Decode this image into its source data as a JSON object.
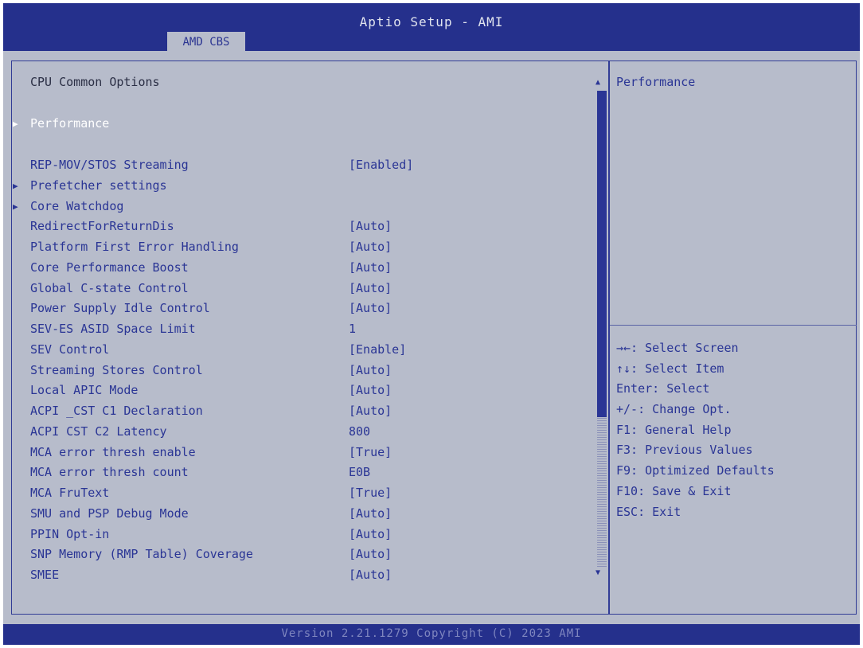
{
  "header": {
    "title": "Aptio Setup - AMI",
    "tab": "AMD CBS"
  },
  "main": {
    "section_title": "CPU Common Options",
    "items": [
      {
        "label": "Performance",
        "value": "",
        "submenu": true,
        "selected": true
      },
      {
        "label": "REP-MOV/STOS Streaming",
        "value": "[Enabled]",
        "submenu": false
      },
      {
        "label": "Prefetcher settings",
        "value": "",
        "submenu": true
      },
      {
        "label": "Core Watchdog",
        "value": "",
        "submenu": true
      },
      {
        "label": "RedirectForReturnDis",
        "value": "[Auto]",
        "submenu": false
      },
      {
        "label": "Platform First Error Handling",
        "value": "[Auto]",
        "submenu": false
      },
      {
        "label": "Core Performance Boost",
        "value": "[Auto]",
        "submenu": false
      },
      {
        "label": "Global C-state Control",
        "value": "[Auto]",
        "submenu": false
      },
      {
        "label": "Power Supply Idle Control",
        "value": "[Auto]",
        "submenu": false
      },
      {
        "label": "SEV-ES ASID Space Limit",
        "value": "1",
        "submenu": false
      },
      {
        "label": "SEV Control",
        "value": "[Enable]",
        "submenu": false
      },
      {
        "label": "Streaming Stores Control",
        "value": "[Auto]",
        "submenu": false
      },
      {
        "label": "Local APIC Mode",
        "value": "[Auto]",
        "submenu": false
      },
      {
        "label": "ACPI _CST C1 Declaration",
        "value": "[Auto]",
        "submenu": false
      },
      {
        "label": "ACPI CST C2 Latency",
        "value": "800",
        "submenu": false
      },
      {
        "label": "MCA error thresh enable",
        "value": "[True]",
        "submenu": false
      },
      {
        "label": "MCA error thresh count",
        "value": "E0B",
        "submenu": false
      },
      {
        "label": "MCA FruText",
        "value": "[True]",
        "submenu": false
      },
      {
        "label": "SMU and PSP Debug Mode",
        "value": "[Auto]",
        "submenu": false
      },
      {
        "label": "PPIN Opt-in",
        "value": "[Auto]",
        "submenu": false
      },
      {
        "label": "SNP Memory (RMP Table) Coverage",
        "value": "[Auto]",
        "submenu": false
      },
      {
        "label": "SMEE",
        "value": "[Auto]",
        "submenu": false
      }
    ]
  },
  "help": {
    "text": "Performance",
    "keys": [
      "→←: Select Screen",
      "↑↓: Select Item",
      "Enter: Select",
      "+/-: Change Opt.",
      "F1: General Help",
      "F3: Previous Values",
      "F9: Optimized Defaults",
      "F10: Save & Exit",
      "ESC: Exit"
    ]
  },
  "icons": {
    "submenu": "triangle-right-icon",
    "scroll_up": "triangle-up-icon",
    "scroll_down": "triangle-down-icon"
  },
  "colors": {
    "header_bg": "#25308c",
    "panel_bg": "#b7bccb",
    "text_blue": "#2a3595",
    "selected": "#ffffff"
  },
  "footer": {
    "version": "Version 2.21.1279 Copyright (C) 2023 AMI"
  }
}
